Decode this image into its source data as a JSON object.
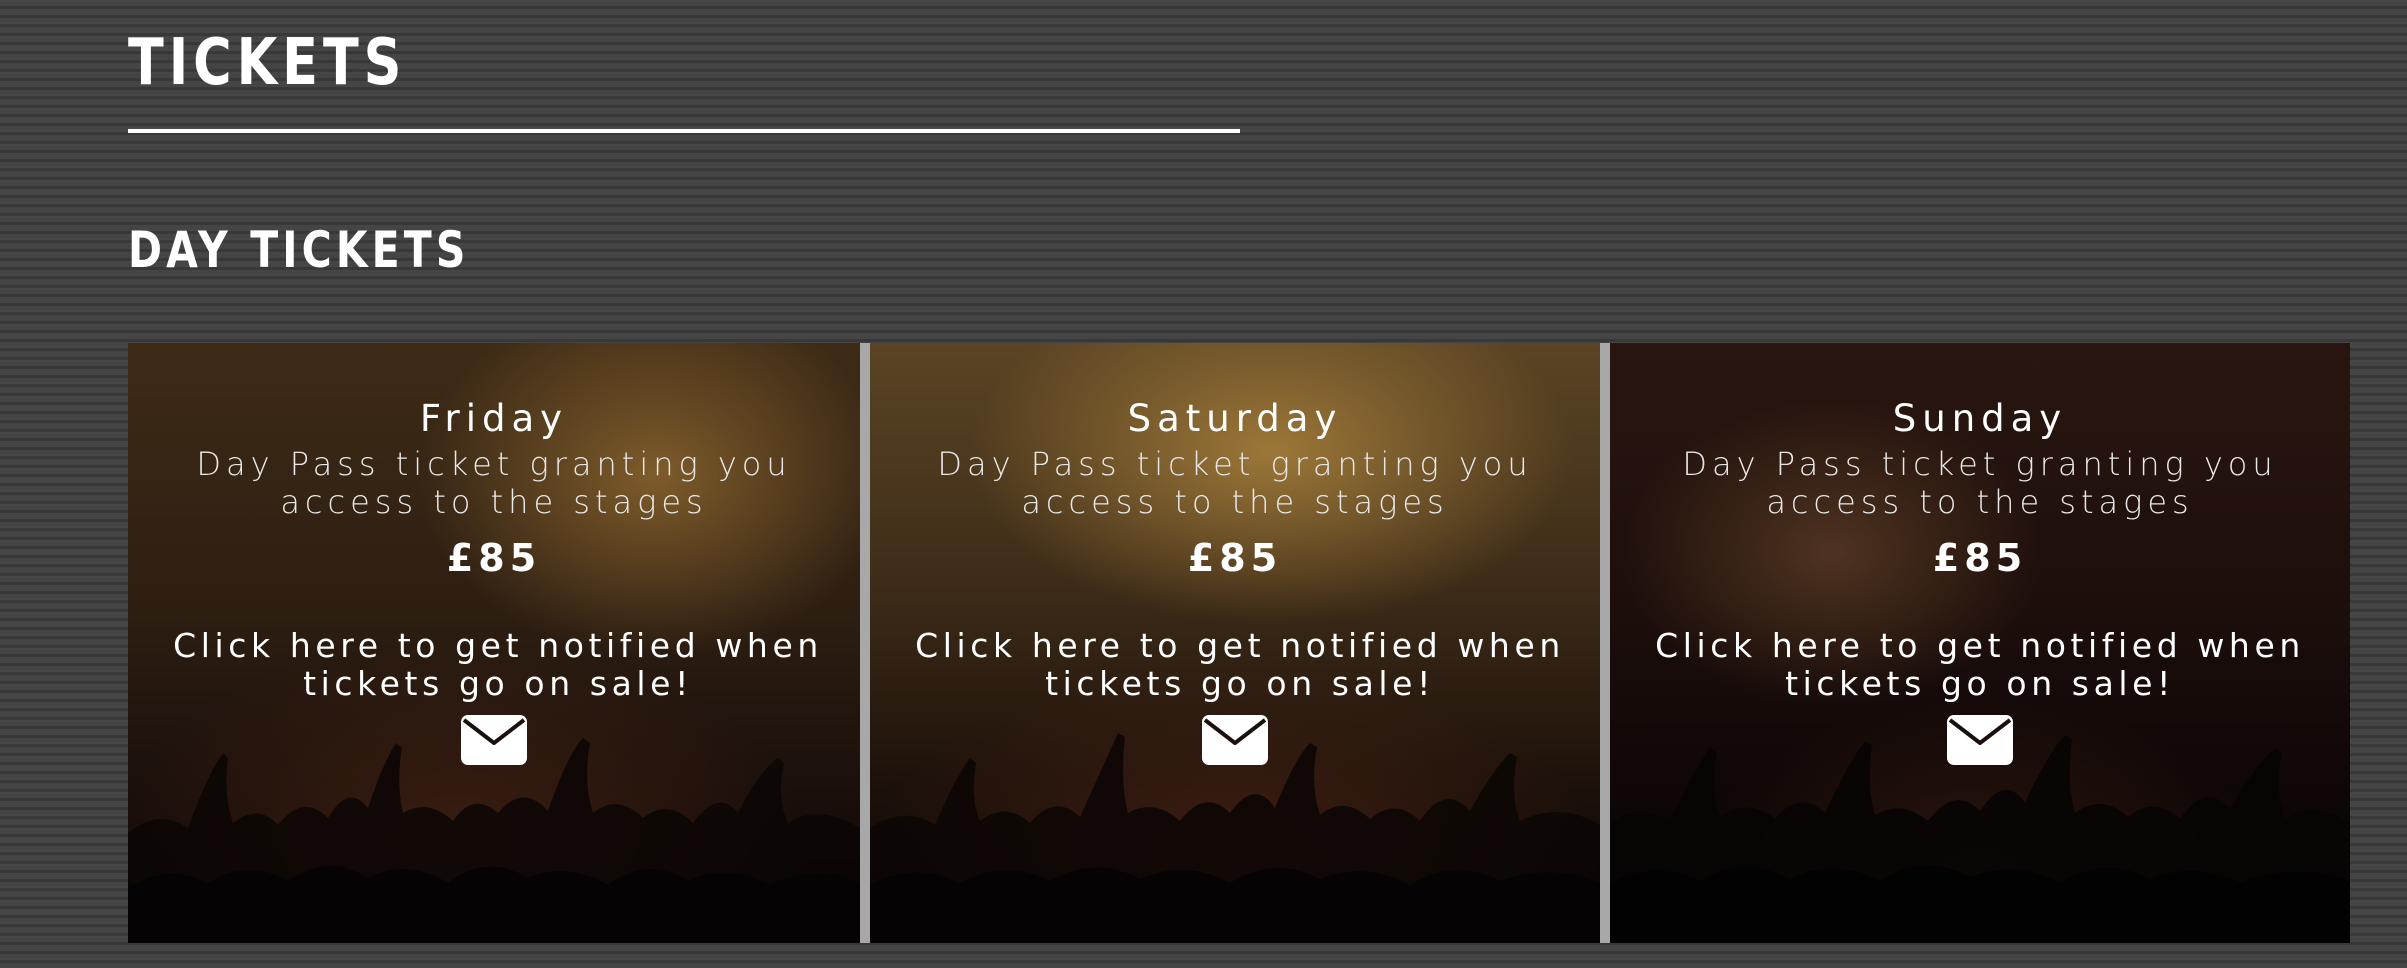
{
  "page": {
    "title": "TICKETS",
    "section_title": "DAY TICKETS"
  },
  "tickets": [
    {
      "day": "Friday",
      "description": "Day Pass ticket granting you access to the stages",
      "price": "£85",
      "notify_text": "Click here to get notified when tickets go on sale!",
      "icon": "envelope-icon"
    },
    {
      "day": "Saturday",
      "description": "Day Pass ticket granting you access to the stages",
      "price": "£85",
      "notify_text": "Click here to get notified when tickets go on sale!",
      "icon": "envelope-icon"
    },
    {
      "day": "Sunday",
      "description": "Day Pass ticket granting you access to the stages",
      "price": "£85",
      "notify_text": "Click here to get notified when tickets go on sale!",
      "icon": "envelope-icon"
    }
  ],
  "colors": {
    "text": "#ffffff",
    "background": "#3c3c3c",
    "card_divider": "#a8a8a8"
  }
}
